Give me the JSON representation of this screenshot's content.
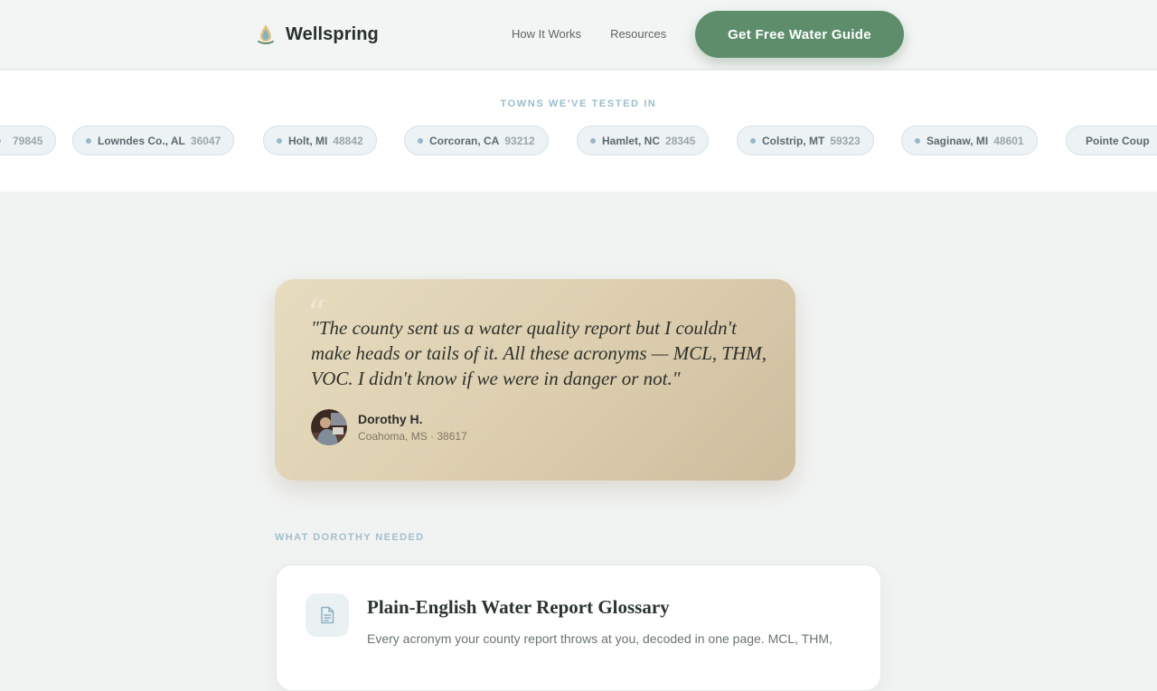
{
  "header": {
    "brand": "Wellspring",
    "nav": [
      "How It Works",
      "Resources"
    ],
    "cta": "Get Free Water Guide"
  },
  "towns": {
    "label": "TOWNS WE'VE TESTED IN",
    "chips": [
      {
        "town": "",
        "zip": "79845"
      },
      {
        "town": "Lowndes Co., AL",
        "zip": "36047"
      },
      {
        "town": "Holt, MI",
        "zip": "48842"
      },
      {
        "town": "Corcoran, CA",
        "zip": "93212"
      },
      {
        "town": "Hamlet, NC",
        "zip": "28345"
      },
      {
        "town": "Colstrip, MT",
        "zip": "59323"
      },
      {
        "town": "Saginaw, MI",
        "zip": "48601"
      },
      {
        "town": "Pointe Coup",
        "zip": ""
      }
    ]
  },
  "testimonial": {
    "quote": "\"The county sent us a water quality report but I couldn't make heads or tails of it. All these acronyms — MCL, THM, VOC. I didn't know if we were in danger or not.\"",
    "name": "Dorothy H.",
    "location": "Coahoma, MS · 38617"
  },
  "needs": {
    "label": "WHAT DOROTHY NEEDED",
    "items": [
      {
        "icon": "document-icon",
        "title": "Plain-English Water Report Glossary",
        "description": "Every acronym your county report throws at you, decoded in one page. MCL, THM,"
      }
    ]
  },
  "colors": {
    "accent": "#5e8d6c",
    "label": "#9bbccd",
    "card_gradient_start": "#e7dcc0",
    "card_gradient_end": "#cdbd9d"
  }
}
